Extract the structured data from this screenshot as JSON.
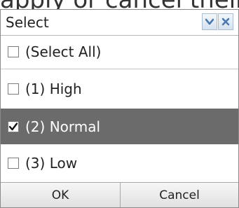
{
  "background": {
    "text": "apply or cancel their c"
  },
  "filter": {
    "header": {
      "label": "Select"
    },
    "items": [
      {
        "label": "(Select All)",
        "checked": false
      },
      {
        "label": "(1) High",
        "checked": false
      },
      {
        "label": "(2) Normal",
        "checked": true
      },
      {
        "label": "(3) Low",
        "checked": false
      }
    ],
    "buttons": {
      "ok": "OK",
      "cancel": "Cancel"
    }
  },
  "colors": {
    "selected_row": "#6b6b6b",
    "header_button_icon": "#4a78b0",
    "footer": "#e8e8e8"
  }
}
